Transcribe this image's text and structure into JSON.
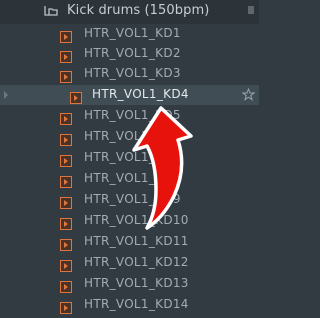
{
  "browser": {
    "folder": {
      "name": "Kick drums (150bpm)",
      "icon": "folder-tree-icon"
    },
    "items": [
      {
        "label": "HTR_VOL1_KD1",
        "icon": "audio-file-icon"
      },
      {
        "label": "HTR_VOL1_KD2",
        "icon": "audio-file-icon"
      },
      {
        "label": "HTR_VOL1_KD3",
        "icon": "audio-file-icon"
      },
      {
        "label": "HTR_VOL1_KD4",
        "icon": "audio-file-icon",
        "selected": true
      },
      {
        "label": "HTR_VOL1_KD5",
        "icon": "audio-file-icon"
      },
      {
        "label": "HTR_VOL1_KD6",
        "icon": "audio-file-icon"
      },
      {
        "label": "HTR_VOL1_KD7",
        "icon": "audio-file-icon"
      },
      {
        "label": "HTR_VOL1_KD8",
        "icon": "audio-file-icon"
      },
      {
        "label": "HTR_VOL1_KD9",
        "icon": "audio-file-icon"
      },
      {
        "label": "HTR_VOL1_KD10",
        "icon": "audio-file-icon"
      },
      {
        "label": "HTR_VOL1_KD11",
        "icon": "audio-file-icon"
      },
      {
        "label": "HTR_VOL1_KD12",
        "icon": "audio-file-icon"
      },
      {
        "label": "HTR_VOL1_KD13",
        "icon": "audio-file-icon"
      },
      {
        "label": "HTR_VOL1_KD14",
        "icon": "audio-file-icon"
      }
    ]
  },
  "colors": {
    "background": "#323b41",
    "selected_row": "#414d55",
    "text": "#a3acb2",
    "text_selected": "#e4e9ec",
    "file_icon": "#dd7540",
    "annotation_arrow": "#e8120c"
  }
}
